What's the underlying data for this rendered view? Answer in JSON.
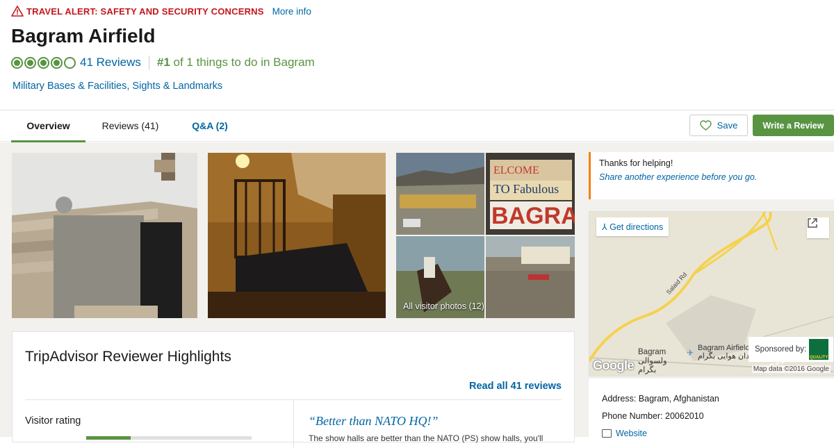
{
  "alert": {
    "text": "TRAVEL ALERT: SAFETY AND SECURITY CONCERNS",
    "link": "More info"
  },
  "title": "Bagram Airfield",
  "rating": {
    "bubbles": 4,
    "max": 5,
    "reviews_label": "41 Reviews",
    "rank_number": "#1",
    "rank_text": " of 1 things to do in Bagram"
  },
  "categories": "Military Bases & Facilities, Sights & Landmarks",
  "tabs": [
    {
      "label": "Overview"
    },
    {
      "label": "Reviews (41)"
    },
    {
      "label": "Q&A (2)"
    }
  ],
  "actions": {
    "save": "Save",
    "write_review": "Write a Review"
  },
  "photos": {
    "all_label": "All visitor photos",
    "all_count": "(12)"
  },
  "highlights": {
    "title": "TripAdvisor Reviewer Highlights",
    "read_all": "Read all 41 reviews",
    "visitor_rating": "Visitor rating",
    "rating_fraction": 0.27,
    "quote": "“Better than NATO HQ!”",
    "snippet": "The show halls are better than the NATO (PS) show halls, you'll"
  },
  "thanks": {
    "line1": "Thanks for helping!",
    "line2": "Share another experience before you go."
  },
  "map": {
    "directions": "Get directions",
    "road": "Salaid Rd",
    "bagram_en": "Bagram",
    "bagram_fa1": "ولسوالی",
    "bagram_fa2": "بگرام",
    "airfield_en": "Bagram Airfield",
    "airfield_fa": "میدان هوایی بگرام",
    "sponsored": "Sponsored by:",
    "sponsor_logo": "QUALITY",
    "google": "Google",
    "map_data": "Map data ©2016 Google"
  },
  "info": {
    "address": "Address: Bagram, Afghanistan",
    "phone": "Phone Number: 20062010",
    "website": "Website"
  },
  "colors": {
    "brand_green": "#589442",
    "link_blue": "#0065a3",
    "alert_red": "#c4161c"
  }
}
